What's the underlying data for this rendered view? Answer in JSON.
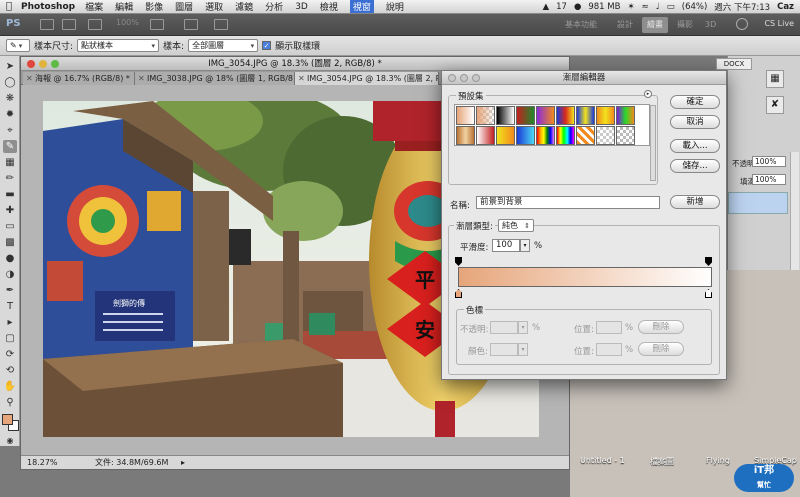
{
  "menubar": {
    "app": "Photoshop",
    "items": [
      "檔案",
      "編輯",
      "影像",
      "圖層",
      "選取",
      "濾鏡",
      "分析",
      "3D",
      "檢視",
      "視窗",
      "說明"
    ],
    "active_index": 9,
    "status": {
      "count": "17",
      "memory": "981 MB",
      "battery": "(64%)",
      "clock": "週六 下午7:13",
      "user": "Caz"
    }
  },
  "appbar": {
    "logo": "PS",
    "zoom": "100%",
    "workspaces": [
      "基本功能",
      "設計",
      "繪畫",
      "攝影",
      "3D"
    ],
    "selected_workspace_index": 2,
    "cslive": "CS Live"
  },
  "optionsbar": {
    "sample_size_label": "樣本尺寸:",
    "sample_size_value": "點狀樣本",
    "sample_label": "樣本:",
    "sample_value": "全部圖層",
    "show_ring_label": "顯示取樣環"
  },
  "document": {
    "window_title": "IMG_3054.JPG @ 18.3% (圖層 2, RGB/8) *",
    "tabs": [
      "海報 @ 16.7% (RGB/8) *",
      "IMG_3038.JPG @ 18% (圖層 1, RGB/8) *",
      "IMG_3054.JPG @ 18.3% (圖層 2, RGB/8) *"
    ],
    "active_tab_index": 2,
    "zoom": "18.27%",
    "file_info": "文件: 34.8M/69.6M",
    "sign_text": "劍獅的傳"
  },
  "lantern_text": [
    "平",
    "安"
  ],
  "right_panels": {
    "docx": "DOCX",
    "opacity_label": "不透明度:",
    "opacity_value": "100%",
    "fill_label": "填滿:",
    "fill_value": "100%"
  },
  "desktop_icons": [
    "Untitled - 1",
    "檔案圖",
    "Flying",
    "SimpleCap"
  ],
  "watermark": {
    "brand": "iT邦",
    "sub": "幫忙"
  },
  "dialog": {
    "title": "漸層編輯器",
    "presets_label": "預設集",
    "ok": "確定",
    "cancel": "取消",
    "load": "載入...",
    "save": "儲存...",
    "name_label": "名稱:",
    "name_value": "前景到背景",
    "new_button": "新增",
    "gradient_type_label": "漸層類型:",
    "gradient_type_value": "純色",
    "smoothness_label": "平滑度:",
    "smoothness_value": "100",
    "percent": "%",
    "stops_label": "色標",
    "opacity_label": "不透明:",
    "location_label": "位置:",
    "delete_label": "刪除",
    "color_label": "顏色:",
    "gradient": {
      "start_color": "#e6a57a",
      "end_color": "#ffffff"
    }
  }
}
